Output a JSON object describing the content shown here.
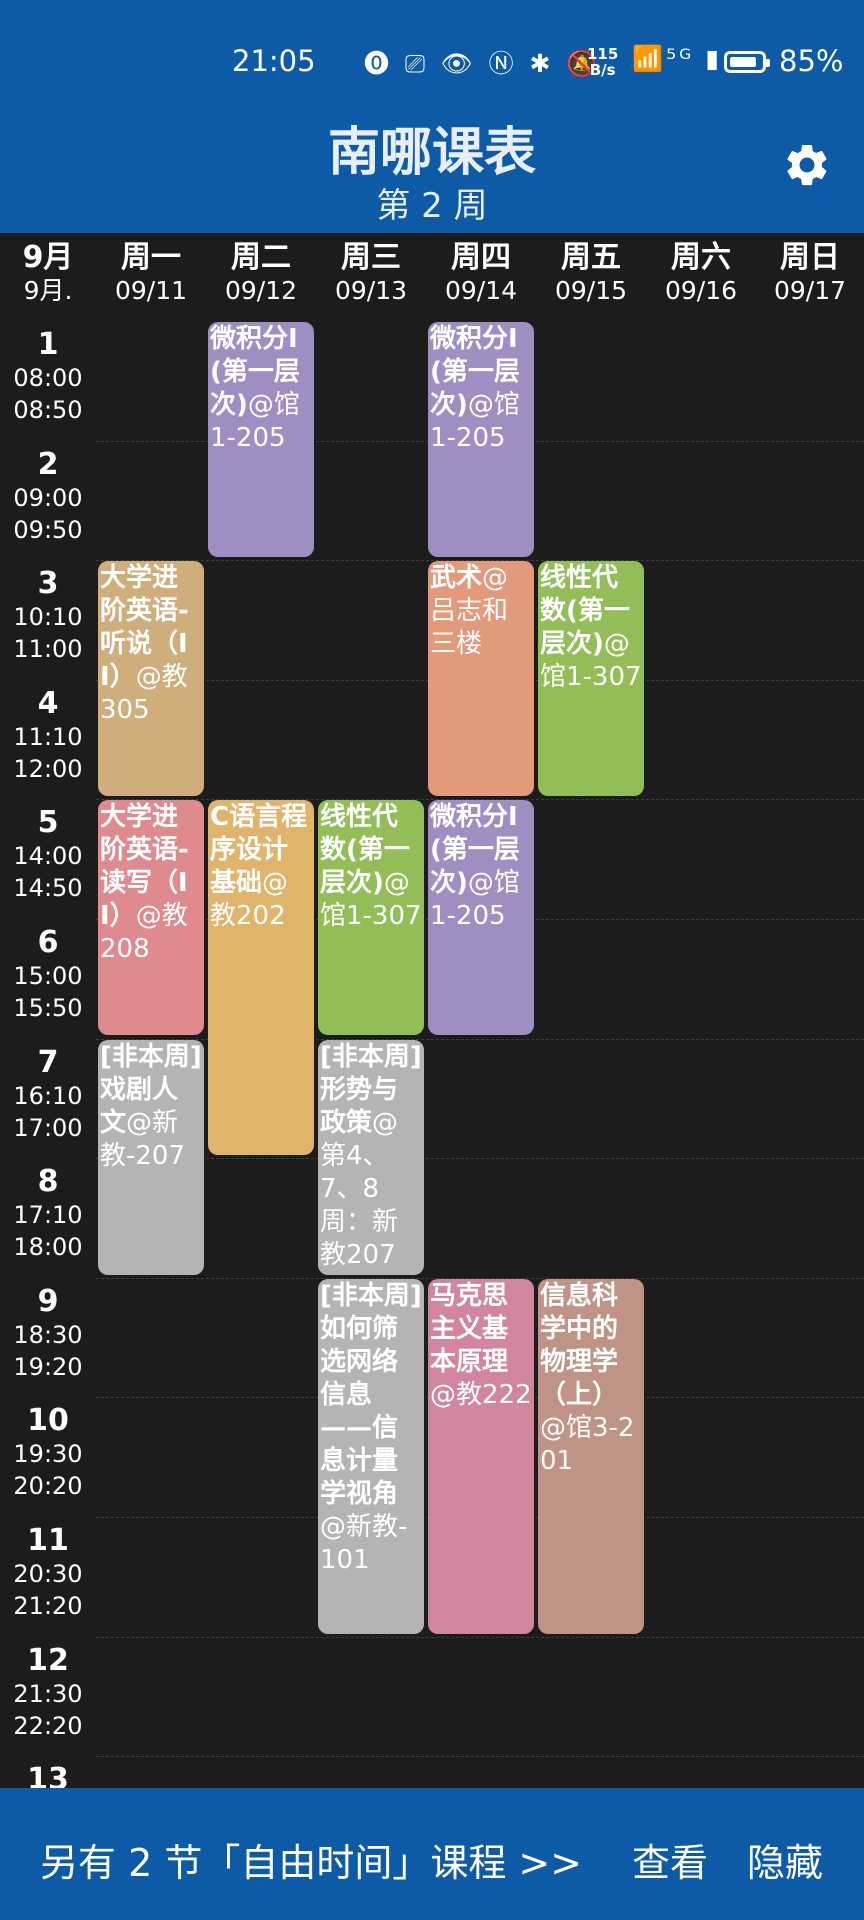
{
  "status_bar": {
    "time": "21:05",
    "left_icons": "⓿ ⎚ 👁 Ⓝ ✱ 🔕",
    "net_speed_value": "115",
    "net_speed_unit": "B/s",
    "signal_icons": "📶⁵ᴳ ▮",
    "battery_percent_text": "85%",
    "battery_level": 0.85
  },
  "header": {
    "title": "南哪课表",
    "week_label": "第 2 周"
  },
  "month_header": {
    "month": "9月",
    "month_sub": "9月."
  },
  "days": [
    {
      "name": "周一",
      "date": "09/11"
    },
    {
      "name": "周二",
      "date": "09/12"
    },
    {
      "name": "周三",
      "date": "09/13"
    },
    {
      "name": "周四",
      "date": "09/14"
    },
    {
      "name": "周五",
      "date": "09/15"
    },
    {
      "name": "周六",
      "date": "09/16"
    },
    {
      "name": "周日",
      "date": "09/17"
    }
  ],
  "periods": [
    {
      "num": "1",
      "start": "08:00",
      "end": "08:50"
    },
    {
      "num": "2",
      "start": "09:00",
      "end": "09:50"
    },
    {
      "num": "3",
      "start": "10:10",
      "end": "11:00"
    },
    {
      "num": "4",
      "start": "11:10",
      "end": "12:00"
    },
    {
      "num": "5",
      "start": "14:00",
      "end": "14:50"
    },
    {
      "num": "6",
      "start": "15:00",
      "end": "15:50"
    },
    {
      "num": "7",
      "start": "16:10",
      "end": "17:00"
    },
    {
      "num": "8",
      "start": "17:10",
      "end": "18:00"
    },
    {
      "num": "9",
      "start": "18:30",
      "end": "19:20"
    },
    {
      "num": "10",
      "start": "19:30",
      "end": "20:20"
    },
    {
      "num": "11",
      "start": "20:30",
      "end": "21:20"
    },
    {
      "num": "12",
      "start": "21:30",
      "end": "22:20"
    },
    {
      "num": "13",
      "start": "",
      "end": ""
    }
  ],
  "courses": [
    {
      "day": 2,
      "start": 1,
      "end": 2,
      "name": "微积分I(第一层次)",
      "loc": "@馆1-205",
      "color": "#a08ec2"
    },
    {
      "day": 4,
      "start": 1,
      "end": 2,
      "name": "微积分I(第一层次)",
      "loc": "@馆1-205",
      "color": "#a08ec2"
    },
    {
      "day": 1,
      "start": 3,
      "end": 4,
      "name": "大学进阶英语-听说（II）",
      "loc": "@教305",
      "color": "#cfae7c"
    },
    {
      "day": 4,
      "start": 3,
      "end": 4,
      "name": "武术",
      "loc": "@吕志和三楼",
      "color": "#e29a7a"
    },
    {
      "day": 5,
      "start": 3,
      "end": 4,
      "name": "线性代数(第一层次)",
      "loc": "@馆1-307",
      "color": "#93be57"
    },
    {
      "day": 1,
      "start": 5,
      "end": 6,
      "name": "大学进阶英语-读写（II）",
      "loc": "@教208",
      "color": "#de8a8e"
    },
    {
      "day": 2,
      "start": 5,
      "end": 7,
      "name": "C语言程序设计基础",
      "loc": "@教202",
      "color": "#e0b46a"
    },
    {
      "day": 3,
      "start": 5,
      "end": 6,
      "name": "线性代数(第一层次)",
      "loc": "@馆1-307",
      "color": "#93be57"
    },
    {
      "day": 4,
      "start": 5,
      "end": 6,
      "name": "微积分I(第一层次)",
      "loc": "@馆1-205",
      "color": "#a08ec2"
    },
    {
      "day": 1,
      "start": 7,
      "end": 8,
      "name": "[非本周]戏剧人文",
      "loc": "@新教-207",
      "color": "#b4b4b4"
    },
    {
      "day": 3,
      "start": 7,
      "end": 8,
      "name": "[非本周]形势与政策",
      "loc": "@第4、7、8周：新教207",
      "color": "#b4b4b4"
    },
    {
      "day": 3,
      "start": 9,
      "end": 11,
      "name": "[非本周]如何筛选网络信息——信息计量学视角",
      "loc": "@新教-101",
      "color": "#b4b4b4"
    },
    {
      "day": 4,
      "start": 9,
      "end": 11,
      "name": "马克思主义基本原理",
      "loc": "@教222",
      "color": "#d2869e"
    },
    {
      "day": 5,
      "start": 9,
      "end": 11,
      "name": "信息科学中的物理学（上）",
      "loc": "@馆3-201",
      "color": "#bf9486"
    }
  ],
  "bottom_bar": {
    "message": "另有 2 节「自由时间」课程 >>",
    "view_label": "查看",
    "hide_label": "隐藏"
  },
  "colors": {
    "primary": "#0d5aa7",
    "background": "#1c1c1c"
  },
  "icons": {
    "settings": "gear-icon"
  }
}
